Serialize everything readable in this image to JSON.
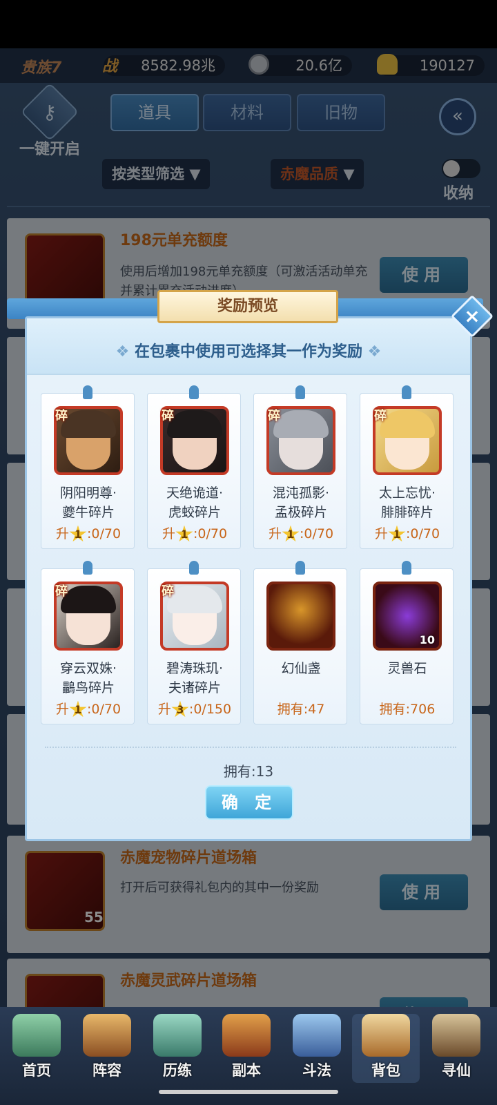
{
  "resources": {
    "vip_label": "贵族7",
    "power_icon_label": "战",
    "power_value": "8582.98兆",
    "coin_value": "20.6亿",
    "gold_value": "190127"
  },
  "header": {
    "one_key_open": "一键开启",
    "tabs": [
      {
        "label": "道具",
        "active": true
      },
      {
        "label": "材料",
        "active": false
      },
      {
        "label": "旧物",
        "active": false
      }
    ],
    "filter_type": "按类型筛选",
    "filter_quality": "赤魔品质",
    "collapse_label": "收纳"
  },
  "items": [
    {
      "name": "198元单充额度",
      "desc": "使用后增加198元单充额度（可激活活动单充并累计累充活动进度）",
      "use_label": "使用"
    },
    {
      "name": "赤魔宠物碎片道场箱",
      "desc": "打开后可获得礼包内的其中一份奖励",
      "use_label": "使用",
      "count": "55"
    },
    {
      "name": "赤魔灵武碎片道场箱",
      "desc": "",
      "use_label": "使用"
    }
  ],
  "modal": {
    "title": "奖励预览",
    "subtitle": "在包裹中使用可选择其一作为奖励",
    "owned": "拥有:13",
    "confirm": "确 定",
    "rewards": [
      {
        "fragment_tag": "碎",
        "name_line1": "阴阳明尊·",
        "name_line2": "夔牛碎片",
        "prefix": "升",
        "star": "1",
        "progress": ":0/70"
      },
      {
        "fragment_tag": "碎",
        "name_line1": "天绝诡道·",
        "name_line2": "虎蛟碎片",
        "prefix": "升",
        "star": "1",
        "progress": ":0/70"
      },
      {
        "fragment_tag": "碎",
        "name_line1": "混沌孤影·",
        "name_line2": "孟极碎片",
        "prefix": "升",
        "star": "1",
        "progress": ":0/70"
      },
      {
        "fragment_tag": "碎",
        "name_line1": "太上忘忧·",
        "name_line2": "腓腓碎片",
        "prefix": "升",
        "star": "1",
        "progress": ":0/70"
      },
      {
        "fragment_tag": "碎",
        "name_line1": "穿云双姝·",
        "name_line2": "鸓鸟碎片",
        "prefix": "升",
        "star": "1",
        "progress": ":0/70"
      },
      {
        "fragment_tag": "碎",
        "name_line1": "碧涛珠玑·",
        "name_line2": "夫诸碎片",
        "prefix": "升",
        "star": "3",
        "progress": ":0/150"
      },
      {
        "fragment_tag": "",
        "name_line1": "幻仙盏",
        "name_line2": "",
        "prefix": "",
        "star": "",
        "progress": "拥有:47"
      },
      {
        "fragment_tag": "",
        "name_line1": "灵兽石",
        "name_line2": "",
        "prefix": "",
        "star": "",
        "progress": "拥有:706",
        "badge": "10"
      }
    ]
  },
  "nav": [
    {
      "label": "首页"
    },
    {
      "label": "阵容"
    },
    {
      "label": "历练"
    },
    {
      "label": "副本"
    },
    {
      "label": "斗法"
    },
    {
      "label": "背包"
    },
    {
      "label": "寻仙"
    }
  ],
  "colors": {
    "accent_orange": "#c86a1a",
    "frame_red": "#c43a26",
    "modal_blue": "#3c84c4",
    "star_gold": "#f4c530"
  }
}
